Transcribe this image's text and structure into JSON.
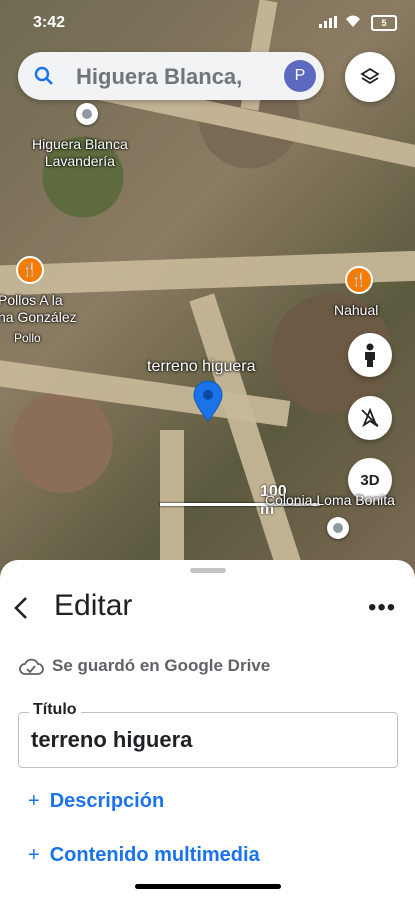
{
  "status": {
    "time": "3:42",
    "battery": "5"
  },
  "search": {
    "query": "Higuera Blanca, ",
    "avatar_letter": "P"
  },
  "map": {
    "labels": [
      "Higuera Blanca\nLavandería",
      "Pollos A la\nna González",
      "Pollo",
      "Nahual",
      "terreno higuera",
      "Colonia Loma Bonita"
    ],
    "scale": "100 m",
    "btn_3d": "3D"
  },
  "sheet": {
    "title": "Editar",
    "saved": "Se guardó en Google Drive",
    "field_label": "Título",
    "field_value": "terreno higuera",
    "add_description": "Descripción",
    "add_media": "Contenido multimedia"
  },
  "colors": {
    "accent": "#1a73e8",
    "pin": "#1a73e8",
    "food": "#f57c00"
  }
}
